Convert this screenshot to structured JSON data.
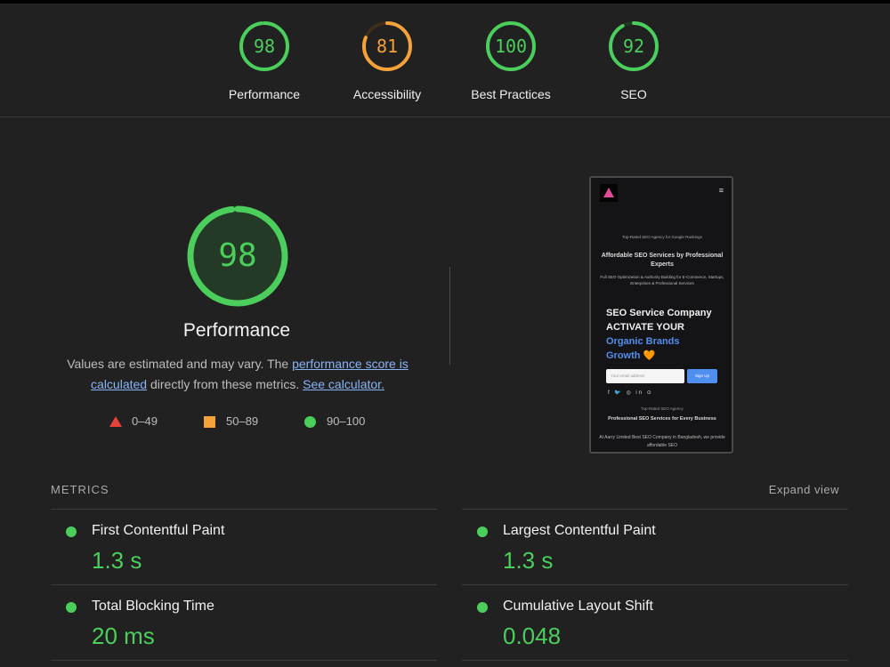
{
  "scores": [
    {
      "label": "Performance",
      "value": "98",
      "fraction": 0.98,
      "color": "#4cce5c"
    },
    {
      "label": "Accessibility",
      "value": "81",
      "fraction": 0.81,
      "color": "#f4a23a"
    },
    {
      "label": "Best Practices",
      "value": "100",
      "fraction": 1.0,
      "color": "#4cce5c"
    },
    {
      "label": "SEO",
      "value": "92",
      "fraction": 0.92,
      "color": "#4cce5c"
    }
  ],
  "performance": {
    "score": "98",
    "fraction": 0.98,
    "title": "Performance",
    "desc_pre": "Values are estimated and may vary. The ",
    "link1": "performance score is calculated",
    "desc_mid": " directly from these metrics. ",
    "link2": "See calculator."
  },
  "legend": [
    {
      "shape": "triangle",
      "range": "0–49",
      "color": "#e4433b"
    },
    {
      "shape": "square",
      "range": "50–89",
      "color": "#f4a23a"
    },
    {
      "shape": "circle",
      "range": "90–100",
      "color": "#4cce5c"
    }
  ],
  "screenshot": {
    "tag": "Top-Rated SEO Agency for Google Rankings",
    "heading": "Affordable SEO Services by Professional Experts",
    "sub": "Full SEO Optimization & Authority Building for E-Commerce, Startups, Enterprises & Professional Services",
    "big_line1": "SEO Service Company",
    "big_line2": "ACTIVATE YOUR",
    "big_line3": "Organic Brands",
    "big_line4": "Growth 🧡",
    "email_placeholder": "Your email address",
    "signup": "Sign Up",
    "social": "f 🐦 ◎ in ⊙",
    "tag2": "Top-Rated SEO Agency",
    "heading2": "Professional SEO Services for Every Business",
    "body": "At Aarry Limited Best SEO Company in Bangladesh, we provide affordable SEO",
    "menu_icon": "≡"
  },
  "metrics": {
    "header": "METRICS",
    "expand": "Expand view",
    "items": [
      {
        "name": "First Contentful Paint",
        "value": "1.3 s"
      },
      {
        "name": "Largest Contentful Paint",
        "value": "1.3 s"
      },
      {
        "name": "Total Blocking Time",
        "value": "20 ms"
      },
      {
        "name": "Cumulative Layout Shift",
        "value": "0.048"
      }
    ]
  },
  "colors": {
    "pass": "#4cce5c",
    "average": "#f4a23a",
    "fail": "#e4433b",
    "link": "#8ab4f8"
  }
}
